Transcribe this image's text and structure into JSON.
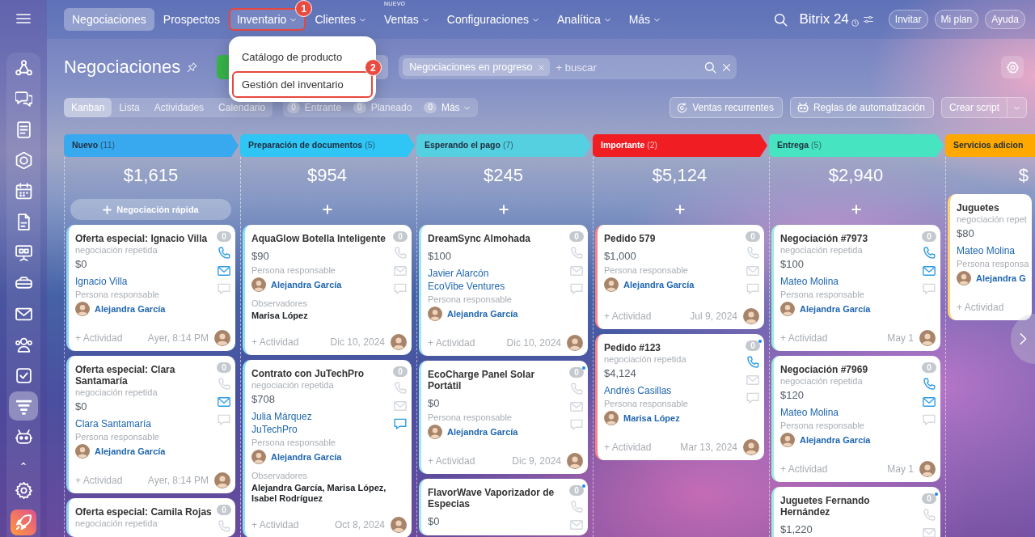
{
  "sidebar": {
    "items": [
      {
        "selected": false
      },
      {
        "selected": false
      },
      {
        "selected": false
      },
      {
        "selected": false
      },
      {
        "selected": false
      },
      {
        "selected": false
      },
      {
        "selected": false
      },
      {
        "selected": false
      },
      {
        "selected": false
      },
      {
        "selected": false
      },
      {
        "selected": false
      },
      {
        "selected": true
      },
      {
        "selected": false
      },
      {
        "selected": false
      },
      {
        "selected": false
      },
      {
        "selected": false
      }
    ]
  },
  "nav": {
    "items": [
      {
        "label": "Negociaciones",
        "selected": true,
        "has_menu": false
      },
      {
        "label": "Prospectos",
        "selected": false,
        "has_menu": false
      },
      {
        "label": "Inventario",
        "selected": false,
        "has_menu": true,
        "callout": "1",
        "menu": [
          {
            "label": "Catálogo de producto"
          },
          {
            "label": "Gestión del inventario",
            "callout": "2"
          }
        ]
      },
      {
        "label": "Clientes",
        "selected": false,
        "has_menu": true
      },
      {
        "label": "Ventas",
        "selected": false,
        "has_menu": true,
        "badge": "NUEVO"
      },
      {
        "label": "Configuraciones",
        "selected": false,
        "has_menu": true
      },
      {
        "label": "Analítica",
        "selected": false,
        "has_menu": true
      },
      {
        "label": "Más",
        "selected": false,
        "has_menu": true
      }
    ],
    "brand": "Bitrix 24",
    "buttons": [
      "Invitar",
      "Mi plan",
      "Ayuda"
    ]
  },
  "page": {
    "title": "Negociaciones",
    "filter": {
      "chips": [
        "Negociaciones en progreso"
      ],
      "placeholder": "+ buscar"
    }
  },
  "toolbar": {
    "views": [
      {
        "label": "Kanban",
        "selected": true
      },
      {
        "label": "Lista",
        "selected": false
      },
      {
        "label": "Actividades",
        "selected": false
      },
      {
        "label": "Calendario",
        "selected": false
      }
    ],
    "counters": [
      {
        "count": "0",
        "label": "Entrante",
        "has_menu": false
      },
      {
        "count": "0",
        "label": "Planeado",
        "has_menu": false
      },
      {
        "count": "0",
        "label": "Más",
        "has_menu": true
      }
    ],
    "buttons": [
      {
        "kind": "recurring",
        "label": "Ventas recurrentes"
      },
      {
        "kind": "automation",
        "label": "Reglas de automatización"
      },
      {
        "kind": "split",
        "label": "Crear script"
      }
    ]
  },
  "columns": [
    {
      "name": "Nuevo",
      "count": "(11)",
      "color": "#39a9ef",
      "total": "$1,615",
      "add": {
        "kind": "quick",
        "label": "Negociación rápida"
      },
      "cards": [
        {
          "title": "Oferta especial: Ignacio Villa",
          "tag": "negociación repetida",
          "amount": "$0",
          "contacts": [
            "Ignacio Villa"
          ],
          "responsible_label": "Persona responsable",
          "responsible": "Alejandra García",
          "activity": "+ Actividad",
          "date": "Ayer, 8:14 PM",
          "counter": "0",
          "counter_dot": false,
          "actions": [
            {
              "kind": "phone",
              "active": true
            },
            {
              "kind": "mail",
              "active": true
            },
            {
              "kind": "chat",
              "active": false
            }
          ]
        },
        {
          "title": "Oferta especial: Clara Santamaría",
          "tag": "negociación repetida",
          "amount": "$0",
          "contacts": [
            "Clara Santamaría"
          ],
          "responsible_label": "Persona responsable",
          "responsible": "Alejandra García",
          "activity": "+ Actividad",
          "date": "Ayer, 8:14 PM",
          "counter": "0",
          "counter_dot": false,
          "actions": [
            {
              "kind": "phone",
              "active": false
            },
            {
              "kind": "mail",
              "active": true
            },
            {
              "kind": "chat",
              "active": false
            }
          ]
        },
        {
          "title": "Oferta especial: Camila Rojas",
          "tag": "negociación repetida",
          "counter": "0",
          "counter_dot": false,
          "actions": [
            {
              "kind": "phone",
              "active": false
            }
          ]
        }
      ]
    },
    {
      "name": "Preparación de documentos",
      "count": "(5)",
      "color": "#2fc6f6",
      "total": "$954",
      "add": {
        "kind": "plus"
      },
      "cards": [
        {
          "title": "AquaGlow Botella Inteligente",
          "amount": "$90",
          "responsible_label": "Persona responsable",
          "responsible": "Alejandra García",
          "observers_label": "Observadores",
          "observers": [
            "Marisa López"
          ],
          "activity": "+ Actividad",
          "date": "Dic 10, 2024",
          "counter": "0",
          "counter_dot": false,
          "actions": [
            {
              "kind": "phone",
              "active": false
            },
            {
              "kind": "mail",
              "active": false
            },
            {
              "kind": "chat",
              "active": false
            }
          ]
        },
        {
          "title": "Contrato con JuTechPro",
          "tag": "negociación repetida",
          "amount": "$708",
          "contacts": [
            "Julia Márquez",
            "JuTechPro"
          ],
          "responsible_label": "Persona responsable",
          "responsible": "Alejandra García",
          "observers_label": "Observadores",
          "observers": [
            "Alejandra García,",
            "Marisa López,",
            "Isabel Rodríguez"
          ],
          "activity": "+ Actividad",
          "date": "Oct 8, 2024",
          "counter": "0",
          "counter_dot": false,
          "actions": [
            {
              "kind": "phone",
              "active": false
            },
            {
              "kind": "mail",
              "active": false
            },
            {
              "kind": "chat",
              "active": true
            }
          ]
        }
      ]
    },
    {
      "name": "Esperando el pago",
      "count": "(7)",
      "color": "#55d0e0",
      "total": "$245",
      "add": {
        "kind": "plus"
      },
      "cards": [
        {
          "title": "DreamSync Almohada",
          "amount": "$100",
          "contacts": [
            "Javier Alarcón",
            "EcoVibe Ventures"
          ],
          "responsible_label": "Persona responsable",
          "responsible": "Alejandra García",
          "activity": "+ Actividad",
          "date": "Dic 10, 2024",
          "counter": "0",
          "counter_dot": false,
          "actions": [
            {
              "kind": "phone",
              "active": false
            },
            {
              "kind": "mail",
              "active": false
            },
            {
              "kind": "chat",
              "active": false
            }
          ]
        },
        {
          "title": "EcoCharge Panel Solar Portátil",
          "amount": "$0",
          "responsible_label": "Persona responsable",
          "responsible": "Alejandra García",
          "activity": "+ Actividad",
          "date": "Dic 9, 2024",
          "counter": "0",
          "counter_dot": true,
          "actions": [
            {
              "kind": "phone",
              "active": false
            },
            {
              "kind": "mail",
              "active": false
            },
            {
              "kind": "chat",
              "active": false
            }
          ]
        },
        {
          "title": "FlavorWave Vaporizador de Especias",
          "amount": "$0",
          "counter": "0",
          "counter_dot": true,
          "actions": [
            {
              "kind": "phone",
              "active": false
            },
            {
              "kind": "mail",
              "active": false
            }
          ]
        }
      ]
    },
    {
      "name": "Importante",
      "count": "(2)",
      "color": "#f01e23",
      "total": "$5,124",
      "add": {
        "kind": "plus"
      },
      "cards": [
        {
          "title": "Pedido 579",
          "amount": "$1,000",
          "responsible_label": "Persona responsable",
          "responsible": "Alejandra García",
          "activity": "+ Actividad",
          "date": "Jul 9, 2024",
          "counter": "0",
          "counter_dot": false,
          "actions": [
            {
              "kind": "phone",
              "active": false
            },
            {
              "kind": "mail",
              "active": false
            },
            {
              "kind": "chat",
              "active": false
            }
          ]
        },
        {
          "title": "Pedido #123",
          "tag": "negociación repetida",
          "amount": "$4,124",
          "contacts": [
            "Andrés Casillas"
          ],
          "responsible_label": "Persona responsable",
          "responsible": "Marisa López",
          "activity": "+ Actividad",
          "date": "Mar 13, 2024",
          "counter": "0",
          "counter_dot": true,
          "actions": [
            {
              "kind": "phone",
              "active": true
            },
            {
              "kind": "mail",
              "active": false
            },
            {
              "kind": "chat",
              "active": false
            }
          ]
        }
      ]
    },
    {
      "name": "Entrega",
      "count": "(5)",
      "color": "#47e4c2",
      "total": "$2,940",
      "add": {
        "kind": "plus"
      },
      "cards": [
        {
          "title": "Negociación #7973",
          "tag": "negociación repetida",
          "amount": "$100",
          "contacts": [
            "Mateo Molina"
          ],
          "responsible_label": "Persona responsable",
          "responsible": "Alejandra García",
          "activity": "+ Actividad",
          "date": "May 1",
          "counter": "0",
          "counter_dot": false,
          "actions": [
            {
              "kind": "phone",
              "active": true
            },
            {
              "kind": "mail",
              "active": true
            },
            {
              "kind": "chat",
              "active": false
            }
          ]
        },
        {
          "title": "Negociación #7969",
          "tag": "negociación repetida",
          "amount": "$120",
          "contacts": [
            "Mateo Molina"
          ],
          "responsible_label": "Persona responsable",
          "responsible": "Alejandra García",
          "activity": "+ Actividad",
          "date": "May 1",
          "counter": "0",
          "counter_dot": false,
          "actions": [
            {
              "kind": "phone",
              "active": true
            },
            {
              "kind": "mail",
              "active": true
            },
            {
              "kind": "chat",
              "active": false
            }
          ]
        },
        {
          "title": "Juguetes Fernando Hernández",
          "amount": "$1,220",
          "counter": "0",
          "counter_dot": true,
          "actions": [
            {
              "kind": "phone",
              "active": false
            },
            {
              "kind": "mail",
              "active": false
            }
          ]
        }
      ]
    },
    {
      "name": "Servicios adicion",
      "color": "#ffa900",
      "total": "$",
      "cards": [
        {
          "title": "Juguetes",
          "tag": "negociación repet",
          "amount": "$80",
          "contacts": [
            "Mateo Molina"
          ],
          "responsible_label": "Persona responsa",
          "responsible": "Alejandra G",
          "activity": "+ Actividad",
          "counter_dot": false
        }
      ]
    }
  ]
}
